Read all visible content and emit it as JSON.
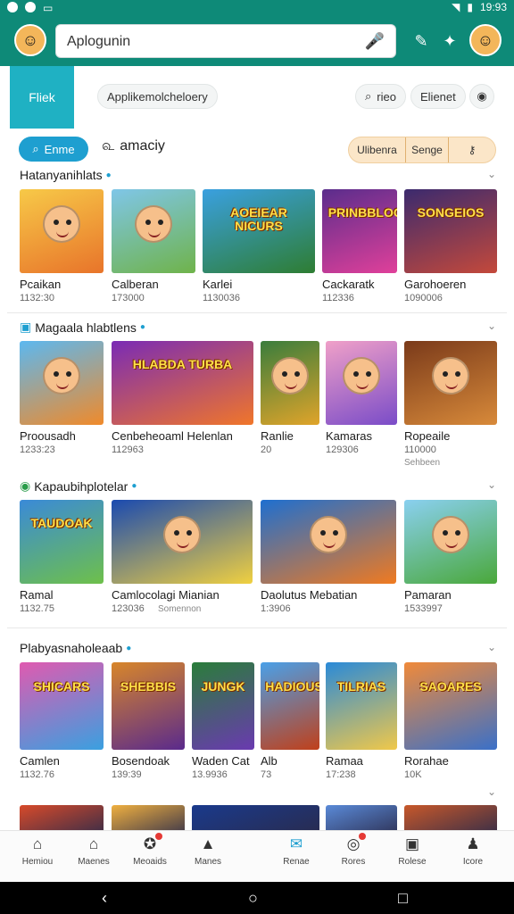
{
  "status_bar": {
    "time": "19:93"
  },
  "app_bar": {
    "search_value": "Aplogunin",
    "icons": [
      "avatar-icon",
      "mic-icon",
      "gamepad-icon",
      "puzzle-icon",
      "avatar-icon"
    ]
  },
  "hero": {
    "logo_text": "Fliek",
    "chip_text": "Applikemolcheloery",
    "search_chip": "rieo",
    "channel_chip": "Elienet"
  },
  "filters": {
    "search_pill": "Enme",
    "chip": "amaciy",
    "segment": [
      "Ulibenra",
      "Senge",
      ""
    ]
  },
  "sections": [
    {
      "title": "Hatanyanihlats",
      "items": [
        {
          "name": "Pcaikan",
          "meta": "1132:30",
          "colors": [
            "#f7c948",
            "#e8742a"
          ],
          "banner": ""
        },
        {
          "name": "Calberan",
          "meta": "173000",
          "colors": [
            "#7fc6e8",
            "#6fb34a"
          ],
          "banner": ""
        },
        {
          "name": "Karlei",
          "meta": "1130036",
          "colors": [
            "#3aa0e0",
            "#2e7d32"
          ],
          "banner": "AOEIEAR NICURS"
        },
        {
          "name": "Cackaratk",
          "meta": "112336",
          "colors": [
            "#5a2d8c",
            "#e0409a"
          ],
          "banner": "PRINBBLOOS"
        },
        {
          "name": "Garohoeren",
          "meta": "1090006",
          "colors": [
            "#3b2a6e",
            "#c4493b"
          ],
          "banner": "SONGEIOS"
        }
      ]
    },
    {
      "title": "Magaala hlabtlens",
      "items": [
        {
          "name": "Proousadh",
          "meta": "1233:23",
          "colors": [
            "#5cb8f0",
            "#f08a2a"
          ],
          "banner": ""
        },
        {
          "name": "Cenbeheoaml Helenlan",
          "meta": "112963",
          "colors": [
            "#7a2bb5",
            "#f0762a"
          ],
          "banner": "HLABDA TURBA"
        },
        {
          "name": "Ranlie",
          "meta": "20",
          "colors": [
            "#3a7d3c",
            "#e0a42a"
          ],
          "banner": ""
        },
        {
          "name": "Kamaras",
          "meta": "129306",
          "colors": [
            "#f0a0c8",
            "#7a4cc8"
          ],
          "banner": ""
        },
        {
          "name": "Ropeaile",
          "meta": "110000",
          "sub": "Sehbeen",
          "colors": [
            "#7a3a1a",
            "#d88a3a"
          ],
          "banner": ""
        }
      ]
    },
    {
      "title": "Kapaubihplotelar",
      "items": [
        {
          "name": "Ramal",
          "meta": "1132.75",
          "colors": [
            "#3a8ad8",
            "#6ec04a"
          ],
          "banner": "TAUDOAK"
        },
        {
          "name": "Camlocolagi Mianian",
          "meta": "123036",
          "sub": "Somennon",
          "colors": [
            "#1a4ab0",
            "#f0d040"
          ],
          "banner": ""
        },
        {
          "name": "Daolutus Mebatian",
          "meta": "1:3906",
          "colors": [
            "#1e6fd0",
            "#f07a20"
          ],
          "banner": ""
        },
        {
          "name": "Pamaran",
          "meta": "1533997",
          "colors": [
            "#8ad0f0",
            "#4aa83a"
          ],
          "banner": ""
        }
      ]
    },
    {
      "title": "Plabyasnaholeaab",
      "items": [
        {
          "name": "Camlen",
          "meta": "1132.76",
          "colors": [
            "#e05ab0",
            "#3aa0e0"
          ],
          "banner": "SHICARS"
        },
        {
          "name": "Bosendoak",
          "meta": "139:39",
          "colors": [
            "#d8862a",
            "#5a2a8c"
          ],
          "banner": "SHEBBIS"
        },
        {
          "name": "Waden Cat",
          "meta": "13.9936",
          "colors": [
            "#2a7d3a",
            "#6a3ab0"
          ],
          "banner": "JUNGK"
        },
        {
          "name": "Alb",
          "meta": "73",
          "colors": [
            "#4aa0e8",
            "#c0401a"
          ],
          "banner": "HADIOUS"
        },
        {
          "name": "Ramaa",
          "meta": "17:238",
          "colors": [
            "#2a8ad8",
            "#f0c84a"
          ],
          "banner": "TILRIAS"
        },
        {
          "name": "Rorahae",
          "meta": "10K",
          "colors": [
            "#f08a3a",
            "#3a70c8"
          ],
          "banner": "SAOARES"
        }
      ]
    }
  ],
  "partial_row_colors": [
    "#d84a2a",
    "#f0b040",
    "#1a3a8c",
    "#5a8ad8",
    "#c8582a"
  ],
  "bottom_nav": [
    {
      "label": "Hemiou",
      "icon": "home-icon"
    },
    {
      "label": "Maenes",
      "icon": "house-icon"
    },
    {
      "label": "Meoaids",
      "icon": "controller-icon"
    },
    {
      "label": "Manes",
      "icon": "cap-icon"
    },
    {
      "label": "Renae",
      "icon": "chat-icon"
    },
    {
      "label": "Rores",
      "icon": "record-icon"
    },
    {
      "label": "Rolese",
      "icon": "box-icon"
    },
    {
      "label": "Icore",
      "icon": "user-icon"
    }
  ]
}
